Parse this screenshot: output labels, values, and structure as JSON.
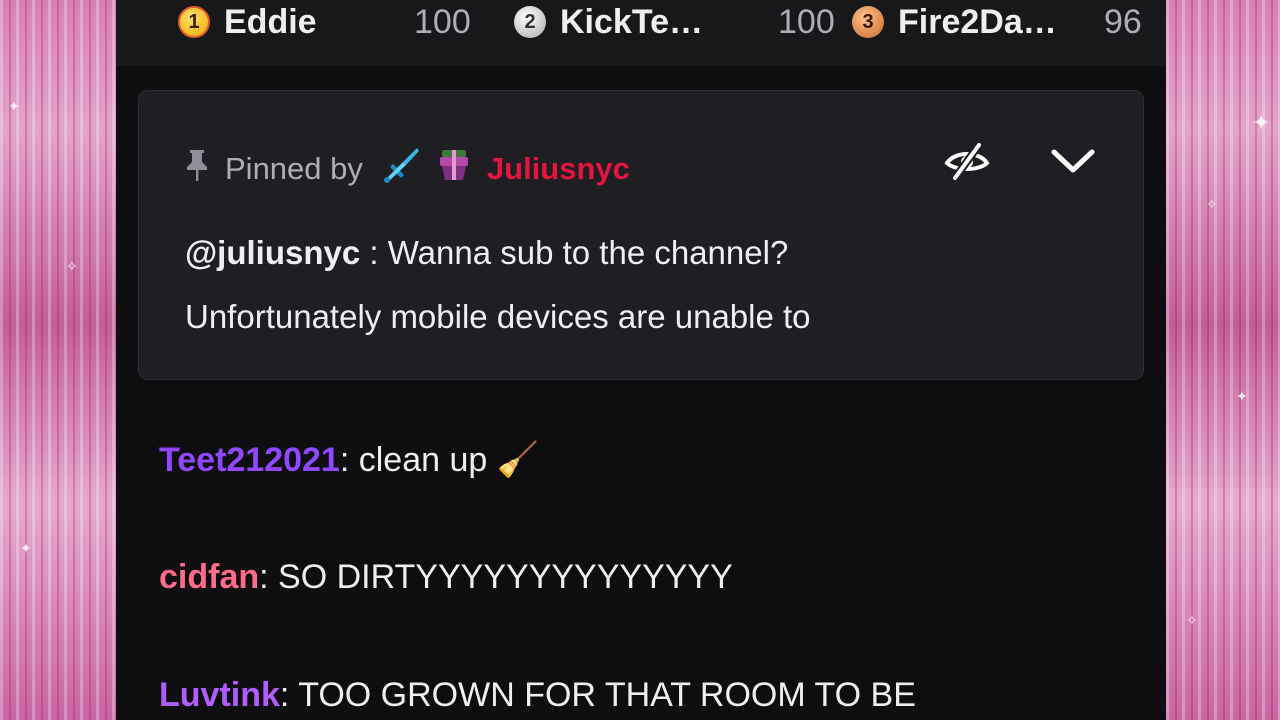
{
  "leaderboard": [
    {
      "rank": "1",
      "name": "Eddie",
      "score": "100"
    },
    {
      "rank": "2",
      "name": "KickTe…",
      "score": "100"
    },
    {
      "rank": "3",
      "name": "Fire2Da…",
      "score": "96"
    }
  ],
  "pinned": {
    "label": "Pinned by",
    "pinner": "Juliusnyc",
    "mention": "@juliusnyc",
    "separator": " : ",
    "message_line1": "Wanna sub to the channel?",
    "message_line2": "Unfortunately mobile devices are unable to"
  },
  "chat": [
    {
      "user": "Teet212021",
      "sep": ":",
      "text": " clean up ",
      "emoji": "🧹",
      "color": "#9147ff"
    },
    {
      "user": "cidfan",
      "sep": ":",
      "text": " SO DIRTYYYYYYYYYYYYYY",
      "color": "#ff6b8b"
    },
    {
      "user": "Luvtink",
      "sep": ":",
      "text": " TOO GROWN FOR THAT ROOM TO BE",
      "color": "#b05cff"
    }
  ],
  "colors": {
    "panel_bg": "#0e0e10",
    "pinned_bg": "#1f1f23",
    "pinner_color": "#e4163f"
  },
  "icons": [
    "pin-icon",
    "sword-badge-icon",
    "gift-badge-icon",
    "eye-slash-icon",
    "chevron-down-icon"
  ]
}
